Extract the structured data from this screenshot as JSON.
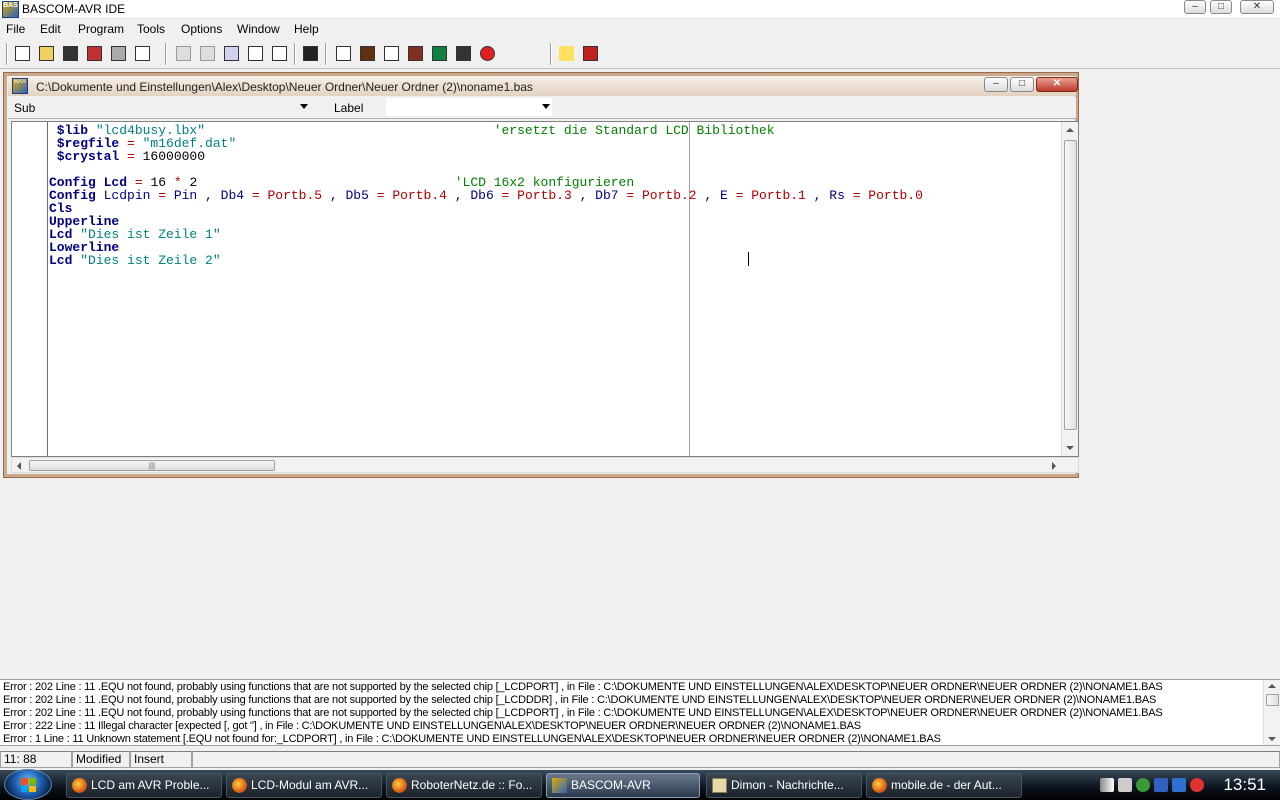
{
  "app": {
    "title": "BASCOM-AVR IDE"
  },
  "menu": [
    "File",
    "Edit",
    "Program",
    "Tools",
    "Options",
    "Window",
    "Help"
  ],
  "toolbar": {
    "buttons": [
      "new-file",
      "open-file",
      "save",
      "save-as",
      "print",
      "print-preview",
      "cut",
      "copy",
      "paste",
      "indent",
      "unindent",
      "find",
      "syntax-check",
      "compile",
      "simulate",
      "program-chip",
      "terminal",
      "lcd-designer",
      "stop",
      "help",
      "exit"
    ]
  },
  "editor": {
    "window_title": "C:\\Dokumente und Einstellungen\\Alex\\Desktop\\Neuer Ordner\\Neuer Ordner (2)\\noname1.bas",
    "sub_label": "Sub",
    "label_label": "Label",
    "lines": [
      {
        "parts": [
          {
            "t": "kw",
            "v": " $lib "
          },
          {
            "t": "str",
            "v": "\"lcd4busy.lbx\""
          },
          {
            "t": "txt",
            "v": "                                     "
          },
          {
            "t": "cm",
            "v": "'ersetzt die Standard LCD Bibliothek"
          }
        ]
      },
      {
        "parts": [
          {
            "t": "kw",
            "v": " $regfile "
          },
          {
            "t": "op",
            "v": "="
          },
          {
            "t": "str",
            "v": " \"m16def.dat\""
          }
        ]
      },
      {
        "parts": [
          {
            "t": "kw",
            "v": " $crystal "
          },
          {
            "t": "op",
            "v": "="
          },
          {
            "t": "num",
            "v": " 16000000"
          }
        ]
      },
      {
        "parts": []
      },
      {
        "parts": [
          {
            "t": "kw",
            "v": "Config Lcd "
          },
          {
            "t": "op",
            "v": "="
          },
          {
            "t": "num",
            "v": " 16 "
          },
          {
            "t": "op",
            "v": "*"
          },
          {
            "t": "num",
            "v": " 2"
          },
          {
            "t": "txt",
            "v": "                                 "
          },
          {
            "t": "cm",
            "v": "'LCD 16x2 konfigurieren"
          }
        ]
      },
      {
        "parts": [
          {
            "t": "kw",
            "v": "Config "
          },
          {
            "t": "txt",
            "v": "Lcdpin "
          },
          {
            "t": "op",
            "v": "="
          },
          {
            "t": "txt",
            "v": " Pin , Db4 "
          },
          {
            "t": "op",
            "v": "="
          },
          {
            "t": "op",
            "v": " Portb.5"
          },
          {
            "t": "txt",
            "v": " , Db5 "
          },
          {
            "t": "op",
            "v": "="
          },
          {
            "t": "op",
            "v": " Portb.4"
          },
          {
            "t": "txt",
            "v": " , Db6 "
          },
          {
            "t": "op",
            "v": "="
          },
          {
            "t": "op",
            "v": " Portb.3"
          },
          {
            "t": "txt",
            "v": " , Db7 "
          },
          {
            "t": "op",
            "v": "="
          },
          {
            "t": "op",
            "v": " Portb.2"
          },
          {
            "t": "txt",
            "v": " , E "
          },
          {
            "t": "op",
            "v": "="
          },
          {
            "t": "op",
            "v": " Portb.1"
          },
          {
            "t": "txt",
            "v": " , Rs "
          },
          {
            "t": "op",
            "v": "="
          },
          {
            "t": "op",
            "v": " Portb.0"
          }
        ]
      },
      {
        "parts": [
          {
            "t": "kw",
            "v": "Cls"
          }
        ]
      },
      {
        "parts": [
          {
            "t": "kw",
            "v": "Upperline"
          }
        ]
      },
      {
        "parts": [
          {
            "t": "kw",
            "v": "Lcd "
          },
          {
            "t": "str",
            "v": "\"Dies ist Zeile 1\""
          }
        ]
      },
      {
        "parts": [
          {
            "t": "kw",
            "v": "Lowerline"
          }
        ]
      },
      {
        "parts": [
          {
            "t": "kw",
            "v": "Lcd "
          },
          {
            "t": "str",
            "v": "\"Dies ist Zeile 2\""
          }
        ]
      }
    ]
  },
  "errors": [
    "Error : 202    Line :    11    .EQU not found, probably using functions that are not supported by the selected chip [_LCDPORT]  , in File : C:\\DOKUMENTE UND EINSTELLUNGEN\\ALEX\\DESKTOP\\NEUER ORDNER\\NEUER ORDNER (2)\\NONAME1.BAS",
    "Error : 202    Line :    11    .EQU not found, probably using functions that are not supported by the selected chip [_LCDDDR]  , in File : C:\\DOKUMENTE UND EINSTELLUNGEN\\ALEX\\DESKTOP\\NEUER ORDNER\\NEUER ORDNER (2)\\NONAME1.BAS",
    "Error : 202    Line :    11    .EQU not found, probably using functions that are not supported by the selected chip [_LCDPORT]  , in File : C:\\DOKUMENTE UND EINSTELLUNGEN\\ALEX\\DESKTOP\\NEUER ORDNER\\NEUER ORDNER (2)\\NONAME1.BAS",
    "Error : 222    Line :    11    Illegal character [expected [, got \"]  , in File : C:\\DOKUMENTE UND EINSTELLUNGEN\\ALEX\\DESKTOP\\NEUER ORDNER\\NEUER ORDNER (2)\\NONAME1.BAS",
    "Error : 1      Line :    11    Unknown statement [.EQU not found for:_LCDPORT]  , in File : C:\\DOKUMENTE UND EINSTELLUNGEN\\ALEX\\DESKTOP\\NEUER ORDNER\\NEUER ORDNER (2)\\NONAME1.BAS"
  ],
  "status": {
    "position": "11: 88",
    "modified": "Modified",
    "mode": "Insert"
  },
  "taskbar": {
    "tasks": [
      {
        "label": "LCD am AVR Proble...",
        "icon": "firefox"
      },
      {
        "label": "LCD-Modul am AVR...",
        "icon": "firefox"
      },
      {
        "label": "RoboterNetz.de :: Fo...",
        "icon": "firefox"
      },
      {
        "label": "BASCOM-AVR",
        "icon": "bascom",
        "active": true
      },
      {
        "label": "Dimon - Nachrichte...",
        "icon": "mail"
      },
      {
        "label": "mobile.de - der Aut...",
        "icon": "firefox"
      }
    ],
    "clock": "13:51"
  }
}
